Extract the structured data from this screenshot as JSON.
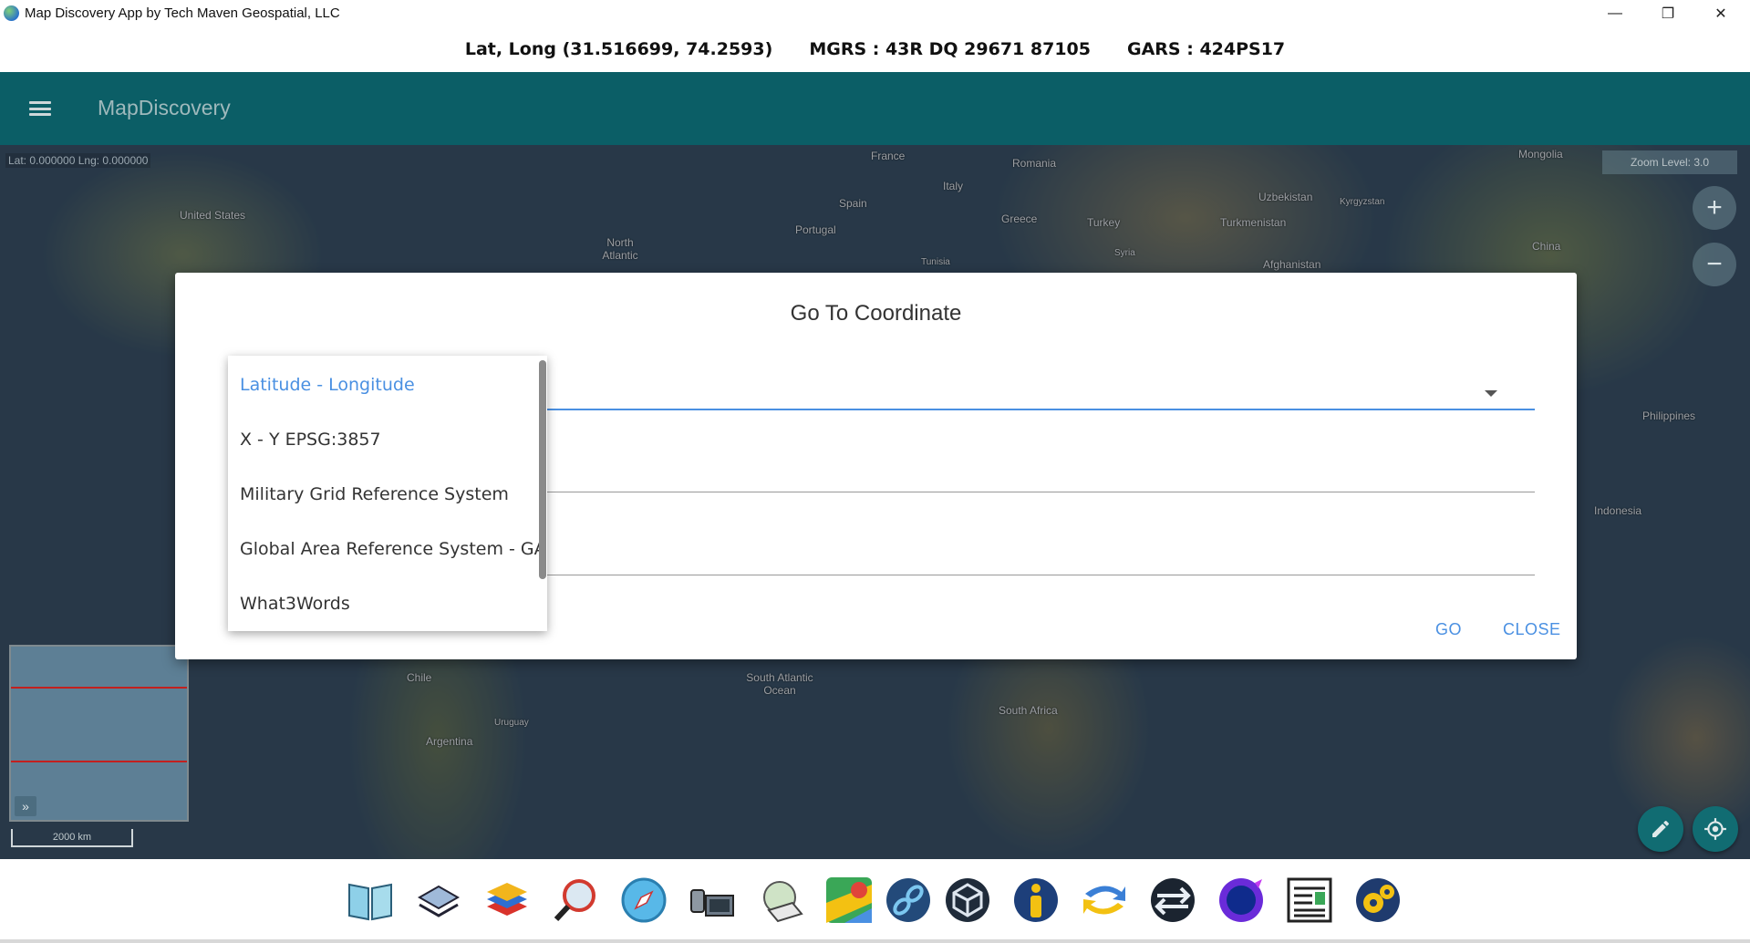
{
  "window": {
    "title": "Map Discovery App by Tech Maven Geospatial, LLC",
    "controls": {
      "minimize": "—",
      "restore": "❐",
      "close": "✕"
    }
  },
  "coord_bar": {
    "latlong": "Lat, Long (31.516699, 74.2593)",
    "mgrs": "MGRS : 43R DQ 29671 87105",
    "gars": "GARS : 424PS17"
  },
  "appbar": {
    "title": "MapDiscovery"
  },
  "map": {
    "latlng_readout": "Lat: 0.000000   Lng: 0.000000",
    "zoom_level": "Zoom Level: 3.0",
    "zoom_in": "+",
    "zoom_out": "−",
    "overview_toggle": "»",
    "scale": "2000 km",
    "labels": [
      "United States",
      "North Atlantic",
      "France",
      "Romania",
      "Italy",
      "Spain",
      "Portugal",
      "Greece",
      "Turkey",
      "Uzbekistan",
      "Kyrgyzstan",
      "Turkmenistan",
      "Afghanistan",
      "Mongolia",
      "China",
      "Tunisia",
      "Syria",
      "Philippines",
      "Indonesia",
      "Chile",
      "Argentina",
      "Uruguay",
      "South Atlantic Ocean",
      "South Africa"
    ]
  },
  "modal": {
    "title": "Go To Coordinate",
    "go_label": "GO",
    "close_label": "CLOSE"
  },
  "dropdown": {
    "options": [
      "Latitude - Longitude",
      "X - Y EPSG:3857",
      "Military Grid Reference System",
      "Global Area Reference System - GARS",
      "What3Words"
    ],
    "selected_index": 0
  },
  "dock": {
    "icons": [
      "map-book-icon",
      "3d-layers-icon",
      "layers-icon",
      "search-zoom-icon",
      "compass-icon",
      "video-camera-icon",
      "offline-maps-icon",
      "google-maps-icon",
      "links-icon",
      "unity-icon",
      "info-icon",
      "sync-icon",
      "data-exchange-icon",
      "globe-icon",
      "reports-icon",
      "settings-icon"
    ]
  },
  "colors": {
    "appbar": "#0b5e66",
    "accent": "#4a90e2",
    "fab": "#116c72"
  }
}
